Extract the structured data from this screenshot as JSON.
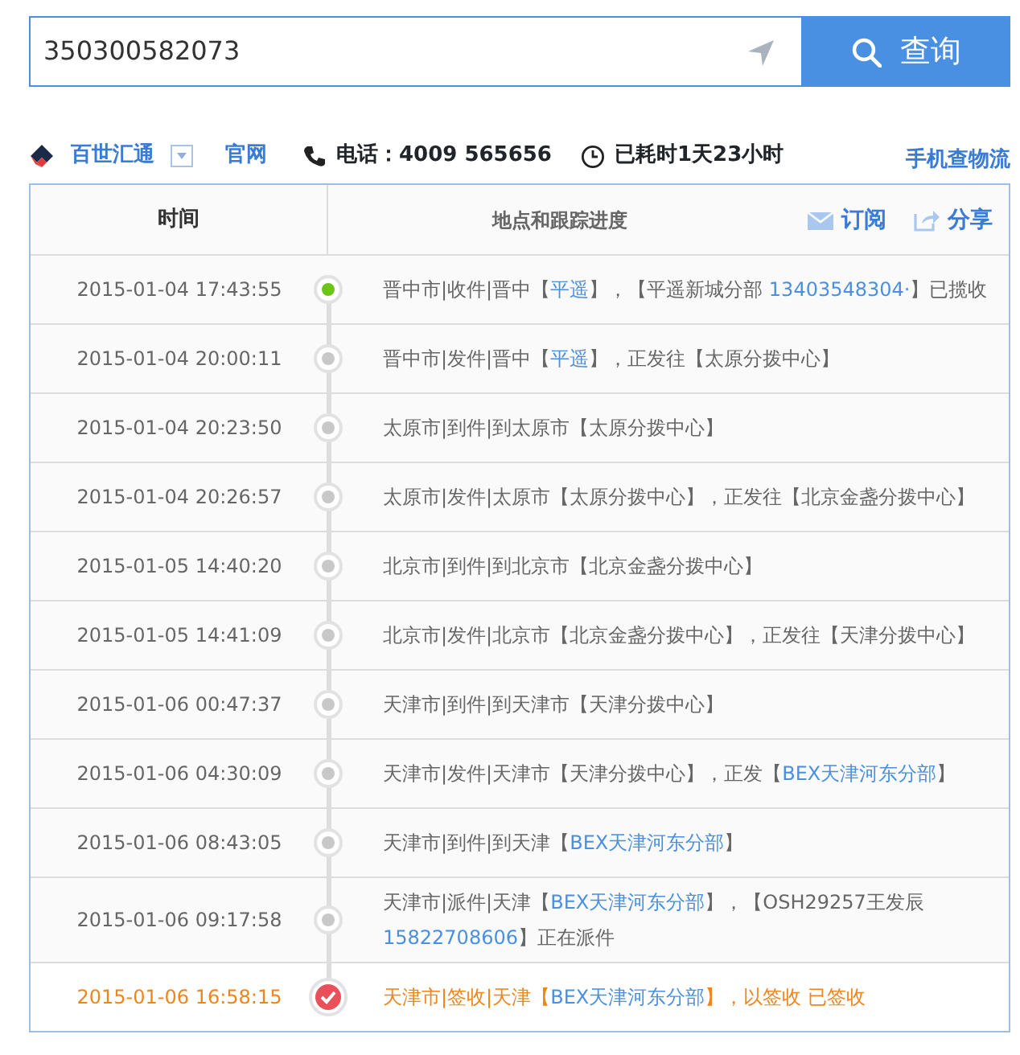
{
  "search": {
    "value": "350300582073",
    "button": "查询"
  },
  "info": {
    "company": "百世汇通",
    "website": "官网",
    "phone": "电话：4009 565656",
    "elapsed": "已耗时1天23小时",
    "mobile": "手机查物流"
  },
  "table": {
    "columns": [
      "时间",
      "地点和跟踪进度"
    ],
    "actions": [
      "订阅",
      "分享"
    ],
    "rows": [
      {
        "time": "2015-01-04 17:43:55",
        "kind": "first",
        "segments": [
          {
            "text": "晋中市|收件|晋中【",
            "link": false
          },
          {
            "text": "平遥",
            "link": true
          },
          {
            "text": "】，【平遥新城分部 ",
            "link": false
          },
          {
            "text": "13403548304·",
            "link": true
          },
          {
            "text": "】已揽收",
            "link": false
          }
        ]
      },
      {
        "time": "2015-01-04 20:00:11",
        "kind": "normal",
        "segments": [
          {
            "text": "晋中市|发件|晋中【",
            "link": false
          },
          {
            "text": "平遥",
            "link": true
          },
          {
            "text": "】，正发往【太原分拨中心】",
            "link": false
          }
        ]
      },
      {
        "time": "2015-01-04 20:23:50",
        "kind": "normal",
        "segments": [
          {
            "text": "太原市|到件|到太原市【太原分拨中心】",
            "link": false
          }
        ]
      },
      {
        "time": "2015-01-04 20:26:57",
        "kind": "normal",
        "segments": [
          {
            "text": "太原市|发件|太原市【太原分拨中心】，正发往【北京金盏分拨中心】",
            "link": false
          }
        ]
      },
      {
        "time": "2015-01-05 14:40:20",
        "kind": "normal",
        "segments": [
          {
            "text": "北京市|到件|到北京市【北京金盏分拨中心】",
            "link": false
          }
        ]
      },
      {
        "time": "2015-01-05 14:41:09",
        "kind": "normal",
        "segments": [
          {
            "text": "北京市|发件|北京市【北京金盏分拨中心】，正发往【天津分拨中心】",
            "link": false
          }
        ]
      },
      {
        "time": "2015-01-06 00:47:37",
        "kind": "normal",
        "segments": [
          {
            "text": "天津市|到件|到天津市【天津分拨中心】",
            "link": false
          }
        ]
      },
      {
        "time": "2015-01-06 04:30:09",
        "kind": "normal",
        "segments": [
          {
            "text": "天津市|发件|天津市【天津分拨中心】，正发【",
            "link": false
          },
          {
            "text": "BEX天津河东分部",
            "link": true
          },
          {
            "text": "】",
            "link": false
          }
        ]
      },
      {
        "time": "2015-01-06 08:43:05",
        "kind": "normal",
        "segments": [
          {
            "text": "天津市|到件|到天津【",
            "link": false
          },
          {
            "text": "BEX天津河东分部",
            "link": true
          },
          {
            "text": "】",
            "link": false
          }
        ]
      },
      {
        "time": "2015-01-06 09:17:58",
        "kind": "normal",
        "segments": [
          {
            "text": "天津市|派件|天津【",
            "link": false
          },
          {
            "text": "BEX天津河东分部",
            "link": true
          },
          {
            "text": "】，【OSH29257王发辰 ",
            "link": false
          },
          {
            "text": "15822708606",
            "link": true
          },
          {
            "text": "】正在派件",
            "link": false
          }
        ]
      },
      {
        "time": "2015-01-06 16:58:15",
        "kind": "signed",
        "segments": [
          {
            "text": "天津市|签收|天津【",
            "link": false
          },
          {
            "text": "BEX天津河东分部",
            "link": true
          },
          {
            "text": "】，以签收 已签收",
            "link": false
          }
        ]
      }
    ]
  }
}
